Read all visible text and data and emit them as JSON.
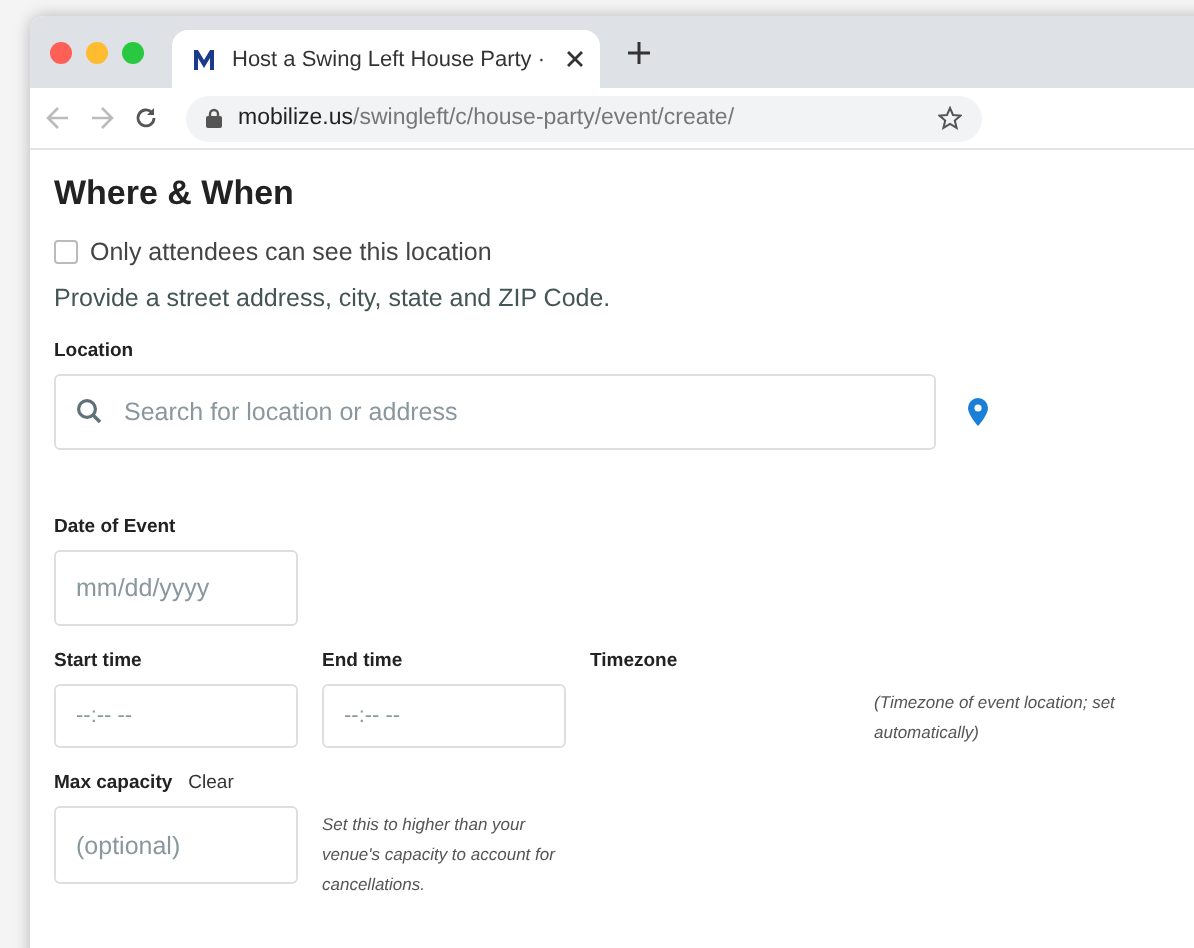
{
  "browser": {
    "tab": {
      "title": "Host a Swing Left House Party ·"
    },
    "url": {
      "host": "mobilize.us",
      "path": "/swingleft/c/house-party/event/create/"
    }
  },
  "section": {
    "title": "Where & When"
  },
  "private_location": {
    "label": "Only attendees can see this location",
    "checked": false
  },
  "instructions": "Provide a street address, city, state and ZIP Code.",
  "location": {
    "label": "Location",
    "placeholder": "Search for location or address"
  },
  "date": {
    "label": "Date of Event",
    "placeholder": "mm/dd/yyyy"
  },
  "start_time": {
    "label": "Start time",
    "placeholder": "--:-- --"
  },
  "end_time": {
    "label": "End time",
    "placeholder": "--:-- --"
  },
  "timezone": {
    "label": "Timezone",
    "note": "(Timezone of event location; set automatically)"
  },
  "max_capacity": {
    "label": "Max capacity",
    "clear": "Clear",
    "placeholder": "(optional)",
    "note": "Set this to higher than your venue's capacity to account for cancellations."
  }
}
